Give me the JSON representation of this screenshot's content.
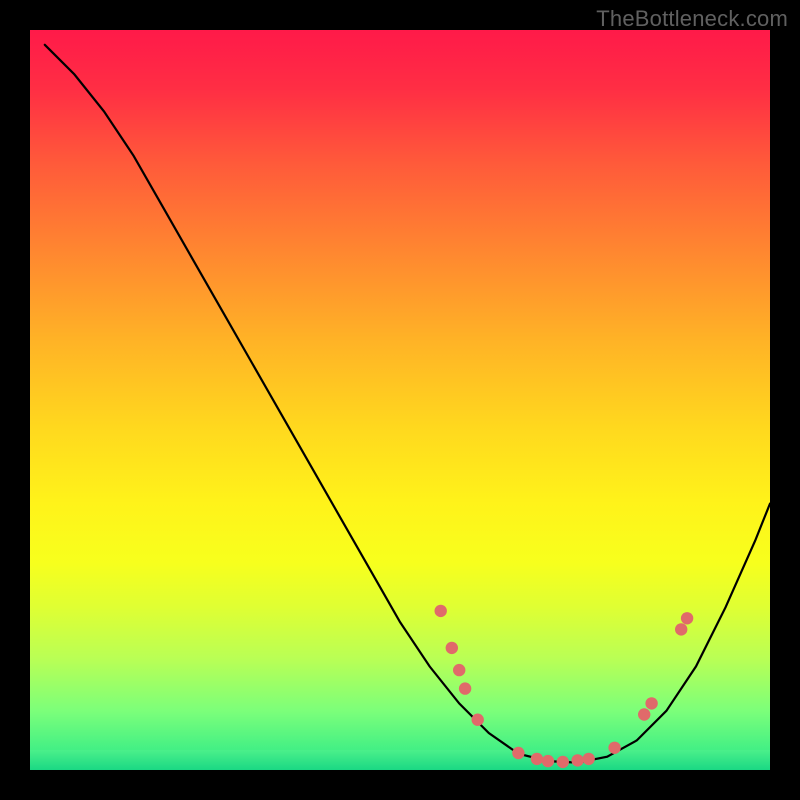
{
  "watermark": "TheBottleneck.com",
  "chart_data": {
    "type": "line",
    "title": "",
    "xlabel": "",
    "ylabel": "",
    "xlim": [
      0,
      100
    ],
    "ylim": [
      0,
      100
    ],
    "series": [
      {
        "name": "curve",
        "x": [
          2,
          6,
          10,
          14,
          18,
          22,
          26,
          30,
          34,
          38,
          42,
          46,
          50,
          54,
          58,
          62,
          66,
          70,
          74,
          78,
          82,
          86,
          90,
          94,
          98,
          100
        ],
        "y": [
          98,
          94,
          89,
          83,
          76,
          69,
          62,
          55,
          48,
          41,
          34,
          27,
          20,
          14,
          9,
          5,
          2.2,
          1.2,
          1.0,
          1.8,
          4,
          8,
          14,
          22,
          31,
          36
        ]
      }
    ],
    "points": [
      {
        "x": 55.5,
        "y": 21.5
      },
      {
        "x": 57.0,
        "y": 16.5
      },
      {
        "x": 58.0,
        "y": 13.5
      },
      {
        "x": 58.8,
        "y": 11.0
      },
      {
        "x": 60.5,
        "y": 6.8
      },
      {
        "x": 66.0,
        "y": 2.3
      },
      {
        "x": 68.5,
        "y": 1.5
      },
      {
        "x": 70.0,
        "y": 1.2
      },
      {
        "x": 72.0,
        "y": 1.1
      },
      {
        "x": 74.0,
        "y": 1.3
      },
      {
        "x": 75.5,
        "y": 1.5
      },
      {
        "x": 79.0,
        "y": 3.0
      },
      {
        "x": 83.0,
        "y": 7.5
      },
      {
        "x": 84.0,
        "y": 9.0
      },
      {
        "x": 88.0,
        "y": 19.0
      },
      {
        "x": 88.8,
        "y": 20.5
      }
    ],
    "gradient_stops": [
      {
        "pos": 0,
        "color": "#ff1a49"
      },
      {
        "pos": 50,
        "color": "#ffd91e"
      },
      {
        "pos": 100,
        "color": "#1ad884"
      }
    ]
  }
}
